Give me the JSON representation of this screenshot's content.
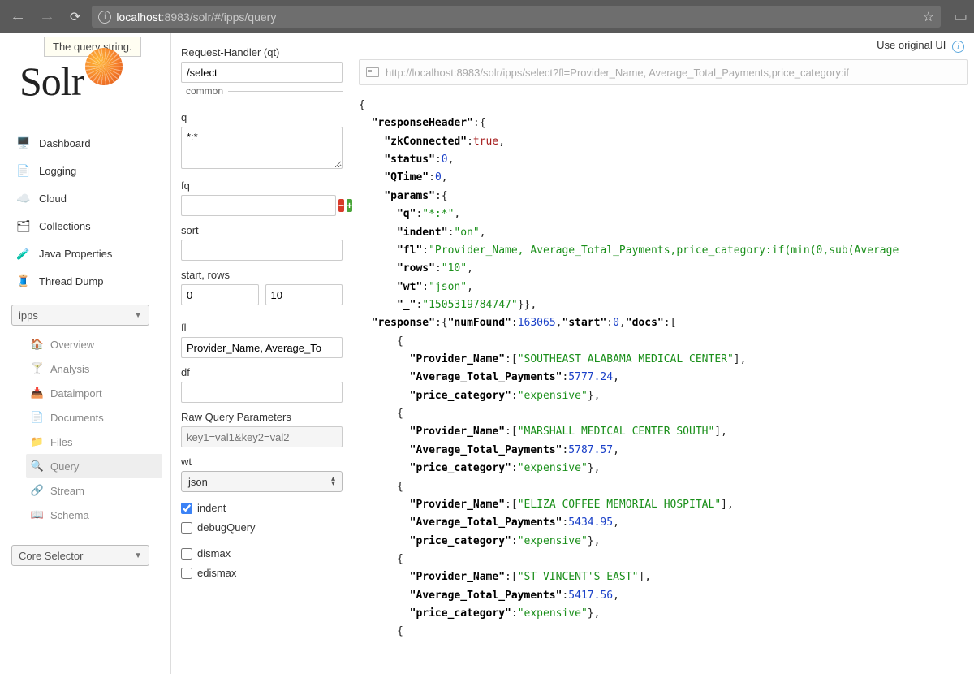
{
  "browser": {
    "url_host": "localhost",
    "url_port": ":8983",
    "url_path": "/solr/#/ipps/query",
    "tooltip": "The query string."
  },
  "top_right": {
    "prefix": "Use ",
    "link": "original UI"
  },
  "logo_text": "Solr",
  "sidebar": {
    "items": [
      {
        "label": "Dashboard",
        "icon": "🖥️"
      },
      {
        "label": "Logging",
        "icon": "📄"
      },
      {
        "label": "Cloud",
        "icon": "☁️"
      },
      {
        "label": "Collections",
        "icon": "🗂"
      },
      {
        "label": "Java Properties",
        "icon": "🧪"
      },
      {
        "label": "Thread Dump",
        "icon": "🧵"
      }
    ],
    "core_selected": "ipps",
    "subnav": [
      {
        "label": "Overview",
        "icon": "🏠"
      },
      {
        "label": "Analysis",
        "icon": "🍸"
      },
      {
        "label": "Dataimport",
        "icon": "📥"
      },
      {
        "label": "Documents",
        "icon": "📄"
      },
      {
        "label": "Files",
        "icon": "📁"
      },
      {
        "label": "Query",
        "icon": "🔍",
        "active": true
      },
      {
        "label": "Stream",
        "icon": "🔗"
      },
      {
        "label": "Schema",
        "icon": "📖"
      }
    ],
    "core_selector_label": "Core Selector"
  },
  "query_form": {
    "qt_label": "Request-Handler (qt)",
    "qt_value": "/select",
    "common_label": "common",
    "q_label": "q",
    "q_value": "*:*",
    "fq_label": "fq",
    "sort_label": "sort",
    "startrows_label": "start, rows",
    "start_value": "0",
    "rows_value": "10",
    "fl_label": "fl",
    "fl_value": "Provider_Name, Average_To",
    "df_label": "df",
    "raw_label": "Raw Query Parameters",
    "raw_placeholder": "key1=val1&key2=val2",
    "wt_label": "wt",
    "wt_value": "json",
    "indent_label": "indent",
    "debugQuery_label": "debugQuery",
    "dismax_label": "dismax",
    "edismax_label": "edismax"
  },
  "result_url": "http://localhost:8983/solr/ipps/select?fl=Provider_Name, Average_Total_Payments,price_category:if",
  "response": {
    "header": {
      "zkConnected": "true",
      "status": "0",
      "QTime": "0",
      "params": {
        "q": "*:*",
        "indent": "on",
        "fl": "Provider_Name, Average_Total_Payments,price_category:if(min(0,sub(Average",
        "rows": "10",
        "wt": "json",
        "_": "1505319784747"
      }
    },
    "numFound": "163065",
    "start": "0",
    "docs": [
      {
        "Provider_Name": "SOUTHEAST ALABAMA MEDICAL CENTER",
        "Average_Total_Payments": "5777.24",
        "price_category": "expensive"
      },
      {
        "Provider_Name": "MARSHALL MEDICAL CENTER SOUTH",
        "Average_Total_Payments": "5787.57",
        "price_category": "expensive"
      },
      {
        "Provider_Name": "ELIZA COFFEE MEMORIAL HOSPITAL",
        "Average_Total_Payments": "5434.95",
        "price_category": "expensive"
      },
      {
        "Provider_Name": "ST VINCENT'S EAST",
        "Average_Total_Payments": "5417.56",
        "price_category": "expensive"
      }
    ]
  }
}
